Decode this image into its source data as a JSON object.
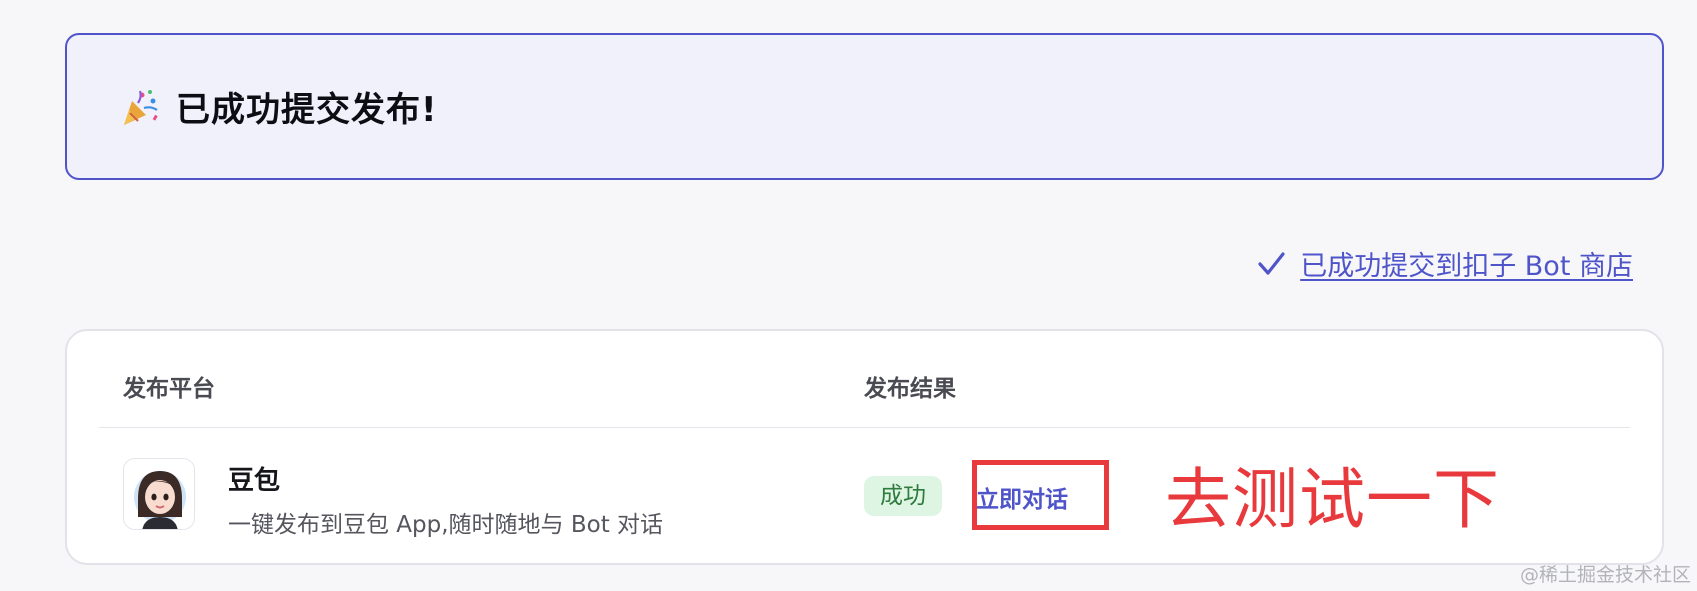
{
  "banner": {
    "icon": "party-popper-icon",
    "title": "已成功提交发布!"
  },
  "store_link": {
    "icon": "check-icon",
    "label": "已成功提交到扣子 Bot 商店"
  },
  "table": {
    "headers": {
      "platform": "发布平台",
      "result": "发布结果"
    },
    "rows": [
      {
        "avatar_icon": "doubao-avatar-icon",
        "platform_name": "豆包",
        "platform_desc": "一键发布到豆包 App,随时随地与 Bot 对话",
        "status": "成功",
        "action_label": "立即对话"
      }
    ]
  },
  "annotation": {
    "text": "去测试一下",
    "color": "#e8393c"
  },
  "watermark": "@稀土掘金技术社区",
  "colors": {
    "accent": "#4f55c9",
    "success_bg": "#dff5e3",
    "success_text": "#2f7a3e"
  }
}
